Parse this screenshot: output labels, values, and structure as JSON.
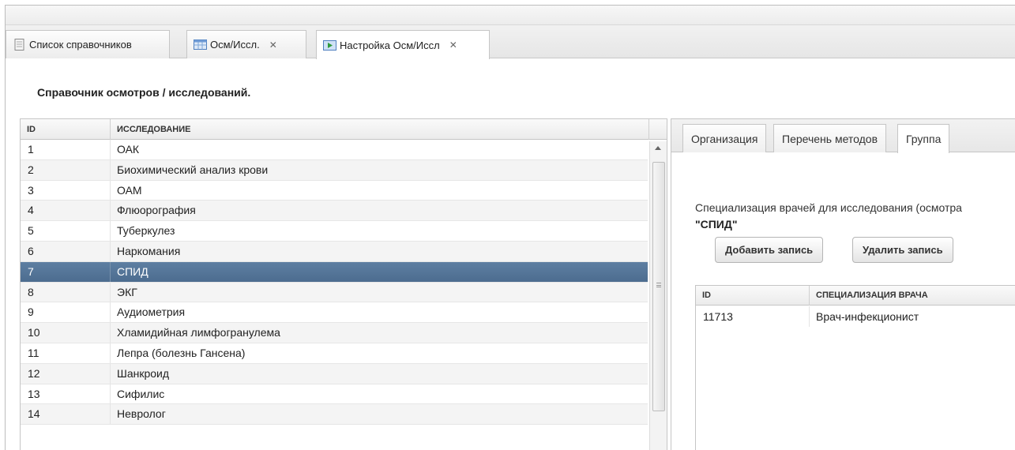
{
  "tabs": [
    {
      "label": "Список справочников",
      "icon": "document-icon",
      "closable": false
    },
    {
      "label": "Осм/Иссл.",
      "icon": "table-icon",
      "closable": true
    },
    {
      "label": "Настройка Осм/Иссл",
      "icon": "play-icon",
      "closable": true
    }
  ],
  "close_glyph": "✕",
  "page_title": "Справочник осмотров / исследований.",
  "exams_table": {
    "columns": [
      "ID",
      "ИССЛЕДОВАНИЕ"
    ],
    "selected_id": "7",
    "rows": [
      {
        "id": "1",
        "name": "ОАК"
      },
      {
        "id": "2",
        "name": "Биохимический анализ крови"
      },
      {
        "id": "3",
        "name": "ОАМ"
      },
      {
        "id": "4",
        "name": "Флюорография"
      },
      {
        "id": "5",
        "name": "Туберкулез"
      },
      {
        "id": "6",
        "name": "Наркомания"
      },
      {
        "id": "7",
        "name": "СПИД"
      },
      {
        "id": "8",
        "name": "ЭКГ"
      },
      {
        "id": "9",
        "name": "Аудиометрия"
      },
      {
        "id": "10",
        "name": "Хламидийная лимфогранулема"
      },
      {
        "id": "11",
        "name": "Лепра (болезнь Гансена)"
      },
      {
        "id": "12",
        "name": "Шанкроид"
      },
      {
        "id": "13",
        "name": "Сифилис"
      },
      {
        "id": "14",
        "name": "Невролог"
      }
    ]
  },
  "detail": {
    "tabs": [
      "Организация",
      "Перечень методов",
      "Группа"
    ],
    "active_tab": "Группа",
    "description": "Специализация врачей для исследования (осмотра",
    "exam_name": "\"СПИД\"",
    "add_label": "Добавить запись",
    "delete_label": "Удалить запись",
    "spec_table": {
      "columns": [
        "ID",
        "СПЕЦИАЛИЗАЦИЯ ВРАЧА"
      ],
      "rows": [
        {
          "id": "11713",
          "name": "Врач-инфекционист"
        }
      ]
    }
  },
  "colors": {
    "selected_row": "#54749a",
    "header_bg": "#ebebeb"
  }
}
